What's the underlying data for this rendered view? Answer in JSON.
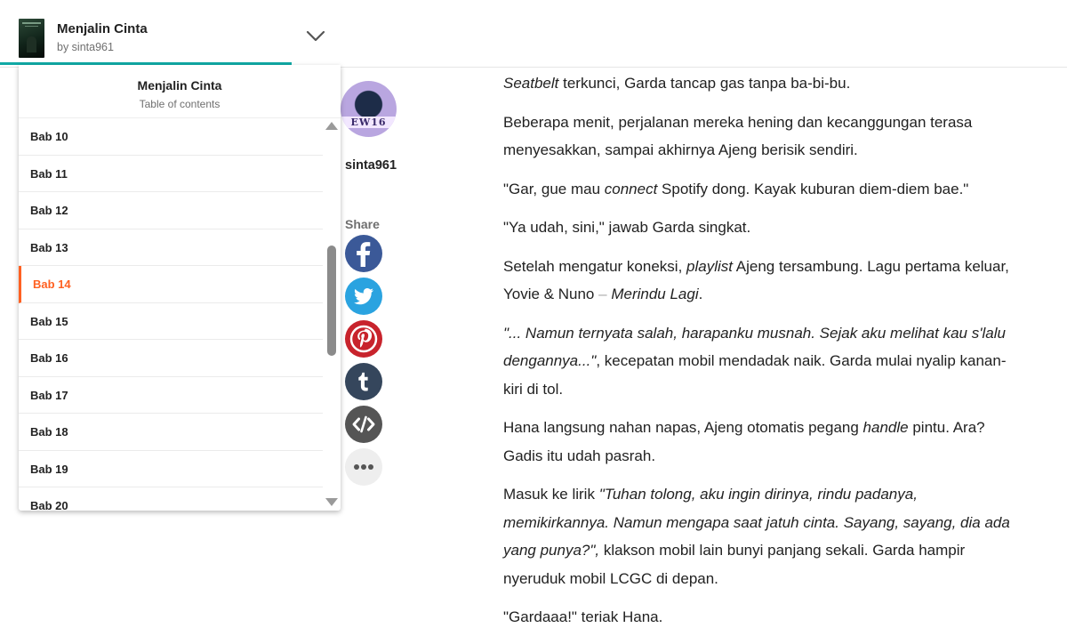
{
  "header": {
    "story_title": "Menjalin Cinta",
    "story_author": "by sinta961"
  },
  "toc": {
    "title": "Menjalin Cinta",
    "subtitle": "Table of contents",
    "chapters": [
      "Bab 10",
      "Bab 11",
      "Bab 12",
      "Bab 13",
      "Bab 14",
      "Bab 15",
      "Bab 16",
      "Bab 17",
      "Bab 18",
      "Bab 19",
      "Bab 20"
    ],
    "active_chapter": "Bab 14"
  },
  "author": {
    "avatar_text": "EW16",
    "name": "sinta961"
  },
  "share": {
    "label": "Share",
    "buttons": [
      "facebook-icon",
      "twitter-icon",
      "pinterest-icon",
      "tumblr-icon",
      "embed-icon",
      "more-icon"
    ]
  },
  "colors": {
    "accent": "#ff6122",
    "teal": "#11a9a5",
    "facebook": "#3b5998",
    "twitter": "#2aa3e0",
    "pinterest": "#c8232c",
    "tumblr": "#35465c",
    "embed": "#555555"
  },
  "story": {
    "p1": {
      "i1": "Seatbelt",
      "t1": " terkunci, Garda tancap gas tanpa ba-bi-bu."
    },
    "p2": "Beberapa menit, perjalanan mereka hening dan kecanggungan terasa menyesakkan, sampai akhirnya Ajeng berisik sendiri.",
    "p3": {
      "t1": "\"Gar, gue mau ",
      "i1": "connect",
      "t2": " Spotify dong. Kayak kuburan diem-diem bae.\""
    },
    "p4": "\"Ya udah, sini,\" jawab Garda singkat.",
    "p5": {
      "t1": "Setelah mengatur koneksi, ",
      "i1": "playlist",
      "t2": " Ajeng tersambung. Lagu pertama keluar, Yovie & Nuno ",
      "dash": "–",
      "i2": "Merindu Lagi",
      "t3": "."
    },
    "p6": {
      "i1": "\"... Namun ternyata salah, harapanku musnah. Sejak aku melihat kau s'lalu dengannya...\"",
      "t1": ", kecepatan mobil mendadak naik. Garda mulai nyalip kanan-kiri di tol."
    },
    "p7": {
      "t1": "Hana langsung nahan napas, Ajeng otomatis pegang ",
      "i1": "handle",
      "t2": " pintu. Ara? Gadis itu udah pasrah."
    },
    "p8": {
      "t1": "Masuk ke lirik ",
      "i1": "\"Tuhan tolong, aku ingin dirinya, rindu padanya, memikirkannya. Namun mengapa saat jatuh cinta. Sayang, sayang, dia ada yang punya?\",",
      "t2": " klakson mobil lain bunyi panjang sekali. Garda hampir nyeruduk mobil LCGC di depan."
    },
    "p9": "\"Gardaaa!\" teriak Hana."
  }
}
